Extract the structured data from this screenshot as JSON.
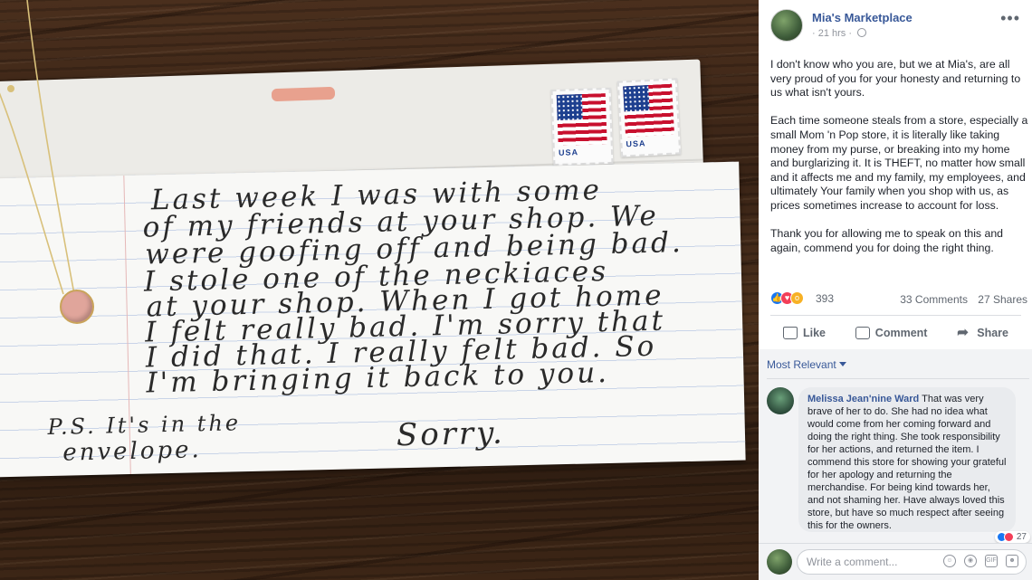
{
  "post": {
    "page_name": "Mia's Marketplace",
    "time": "21 hrs",
    "paragraphs": [
      "I don't know who you are, but we at Mia's, are all very proud of you for your honesty and returning to us what isn't yours.",
      "Each time someone steals from a store, especially a small Mom 'n Pop store, it is literally like taking money from my purse, or breaking into my home and burglarizing it. It is THEFT, no matter how small and it affects me and my family, my employees, and ultimately Your family when you shop with us, as prices sometimes increase to account for loss.",
      "Thank you for allowing me to speak on this and again, commend you for doing the right thing."
    ],
    "reaction_count": "393",
    "comments_count": "33 Comments",
    "shares_count": "27 Shares"
  },
  "actions": {
    "like": "Like",
    "comment": "Comment",
    "share": "Share"
  },
  "comments": {
    "sort_label": "Most Relevant",
    "items": [
      {
        "author": "Melissa Jean'nine Ward",
        "text": "That was very brave of her to do. She had no idea what would come from her coming forward and doing the right thing. She took responsibility for her actions, and returned the item. I commend this store for showing your grateful for her apology and returning the merchandise. For being kind towards her, and not shaming her. Have always loved this store, but have so much respect after seeing this for the owners.",
        "reactions": "27"
      }
    ],
    "write_placeholder": "Write a comment..."
  },
  "photo": {
    "stamp_text": "USA",
    "note_lines": [
      "Last week I was with some",
      "of my friends at your shop. We",
      "were goofing off and being bad.",
      "I stole one of the neckiaces",
      "at your shop. When I got home",
      "I felt really bad. I'm sorry that",
      "I did that. I really felt bad. So",
      "I'm bringing it back to you."
    ],
    "ps_line1": "P.S. It's in the",
    "ps_line2": "envelope.",
    "sorry": "Sorry."
  }
}
